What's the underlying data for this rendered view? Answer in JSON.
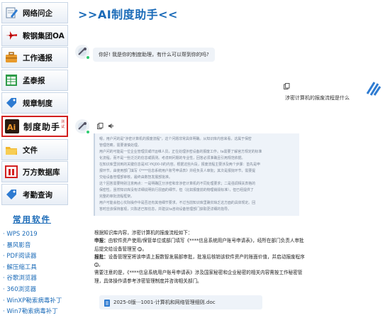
{
  "sidebar": {
    "items": [
      {
        "label": "网络问企"
      },
      {
        "label": "鞍钢集团OA"
      },
      {
        "label": "工作通报"
      },
      {
        "label": "孟泰报"
      },
      {
        "label": "规章制度"
      },
      {
        "label": "制度助手",
        "badge": "测试"
      },
      {
        "label": "文件"
      },
      {
        "label": "万方数据库"
      },
      {
        "label": "考勤查询"
      }
    ],
    "software_title": "常用软件",
    "software": [
      "· WPS 2019",
      "· 暴风影音",
      "· PDF阅读器",
      "· 解压缩工具",
      "· 谷歌浏览器",
      "· 360浏览器",
      "· WinXP勒索病毒补丁",
      "· Win7勒索病毒补丁"
    ]
  },
  "main": {
    "title": ">>AI制度助手<<",
    "greeting": "你好! 我是你的制度助理，有什么可以帮到你的吗?",
    "user_question": "涉密计算机的报废流程是什么",
    "thinking": [
      "嗯，用户问的是\"涉密计算机的报废流程\"，这个问题非常具体明确。从知识库内容来看，这属于保密",
      "管理范畴，需要谨慎处理。",
      "用户问的可能是一位企业管理员或IT运维人员，正在处理涉密设备的报废工作。ta需要了解官方规定的标准",
      "化流程，而不是一些泛泛的信息或猜测。考虑到问题的专业性，回答必须准确且引用规范依据。",
      "在知识库里找到的关键信息是XC-YKJ00-0的内容。根据这些片段，报废流程主要涉及两个步骤：首先是申",
      "报环节，由使用部门填写《****信息系统用户账号申请表》并经负责人审批；其次是报批环节，需要提",
      "交给设备管理部审核，最终由数智发展部批准。",
      "这个回答需要特别注意两点：一是明确区分涉密和非涉密计算机的不同处理要求；二是强调相关表格的",
      "保密性。虽然知识库没有详细说明执行层面的细节，但（比如报废前的物理销毁标准），但已经提供了",
      "完整的审批流程框架。",
      "用户可能会担心实际操作中是否还有其他细节要求，不过当前知识库里确实缺乏这方面的具体规定。回",
      "答时应该保持客观，只陈述已知信息，并建议ta咨询设备管理部门获取更详细的指导。"
    ],
    "answer_intro": "根据知识库内容，涉密计算机的报废流程如下：",
    "step1_title": "申报：",
    "step1_body": "由软件资产使用/保管单位或部门填写《****信息系统用户账号申请表》，经所在部门负责人审批后提交给设备管理室",
    "step2_title": "报批：",
    "step2_body": "设备管理室将该申请上报数智发展部审批，批准后核销该软件资产的账面价值，并启动报废程序",
    "note": "需要注意的是，《****信息系统用户账号申请表》涉及国家秘密和企业秘密的相关内容需按工作秘密管理，具体操作请参考涉密管理制度并咨询相关部门。",
    "ref_mark": "1",
    "doc_label": "2025-0版···1001-计算机和网络管理细则.doc"
  }
}
